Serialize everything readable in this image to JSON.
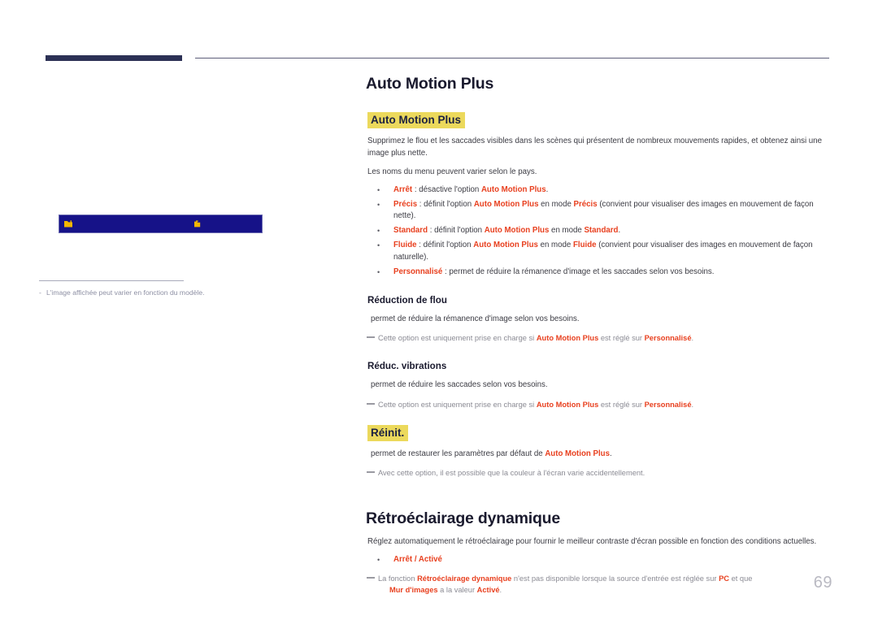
{
  "page": {
    "number": "69",
    "note_left": "L'image affichée peut varier en fonction du modèle.",
    "note_left_dash": "-"
  },
  "colors": {
    "emphasis": "#e8401f",
    "highlight": "#ecd95c",
    "heading": "#1a1a2e",
    "rule_navy": "#2c3155",
    "screen_blue": "#161288",
    "screen_icon": "#f3b600",
    "note_gray": "#8b8b94",
    "page_number": "#b9b9c2"
  },
  "illustration": {
    "name": "osd-menu-bar",
    "icon_left": "folder-icon",
    "icon_right": "folder-icon"
  },
  "sections": [
    {
      "title": "Auto Motion Plus",
      "highlight_heading": "Auto Motion Plus",
      "intro": [
        "Supprimez le flou et les saccades visibles dans les scènes qui présentent de nombreux mouvements rapides, et obtenez ainsi une image plus nette.",
        "Les noms du menu peuvent varier selon le pays."
      ],
      "bullets": [
        {
          "term": "Arrêt",
          "text_after": " : désactive l'option ",
          "em2": "Auto Motion Plus",
          "tail": "."
        },
        {
          "term": "Précis",
          "text_after": " : définit l'option ",
          "em2": "Auto Motion Plus",
          "mid": " en mode ",
          "em3": "Précis",
          "tail": " (convient pour visualiser des images en mouvement de façon nette)."
        },
        {
          "term": "Standard",
          "text_after": " : définit l'option ",
          "em2": "Auto Motion Plus",
          "mid": " en mode ",
          "em3": "Standard",
          "tail": "."
        },
        {
          "term": "Fluide",
          "text_after": " : définit l'option ",
          "em2": "Auto Motion Plus",
          "mid": " en mode ",
          "em3": "Fluide",
          "tail": " (convient pour visualiser des images en mouvement de façon naturelle)."
        },
        {
          "term": "Personnalisé",
          "text_after": " : permet de réduire la rémanence d'image et les saccades selon vos besoins.",
          "em2": "",
          "mid": "",
          "em3": "",
          "tail": ""
        }
      ],
      "subsections": [
        {
          "heading": "Réduction de flou",
          "body": "permet de réduire la rémanence d'image selon vos besoins.",
          "note_pre": "Cette option est uniquement prise en charge si ",
          "note_em1": "Auto Motion Plus",
          "note_mid": " est réglé sur ",
          "note_em2": "Personnalisé",
          "note_tail": "."
        },
        {
          "heading": "Réduc. vibrations",
          "body": "permet de réduire les saccades selon vos besoins.",
          "note_pre": "Cette option est uniquement prise en charge si ",
          "note_em1": "Auto Motion Plus",
          "note_mid": " est réglé sur ",
          "note_em2": "Personnalisé",
          "note_tail": "."
        }
      ],
      "reset": {
        "highlight_heading": "Réinit.",
        "body_pre": "permet de restaurer les paramètres par défaut de ",
        "body_em": "Auto Motion Plus",
        "body_tail": ".",
        "note": "Avec cette option, il est possible que la couleur à l'écran varie accidentellement."
      }
    },
    {
      "title": "Rétroéclairage dynamique",
      "intro": "Réglez automatiquement le rétroéclairage pour fournir le meilleur contraste d'écran possible en fonction des conditions actuelles.",
      "bullet_option": "Arrêt / Activé",
      "note": {
        "pre": "La fonction ",
        "em1": "Rétroéclairage dynamique",
        "mid": " n'est pas disponible lorsque la source d'entrée est réglée sur ",
        "em2": "PC",
        "mid2": " et que",
        "em3": "Mur d'images",
        "mid3": " a la valeur ",
        "em4": "Activé",
        "tail": "."
      }
    }
  ]
}
